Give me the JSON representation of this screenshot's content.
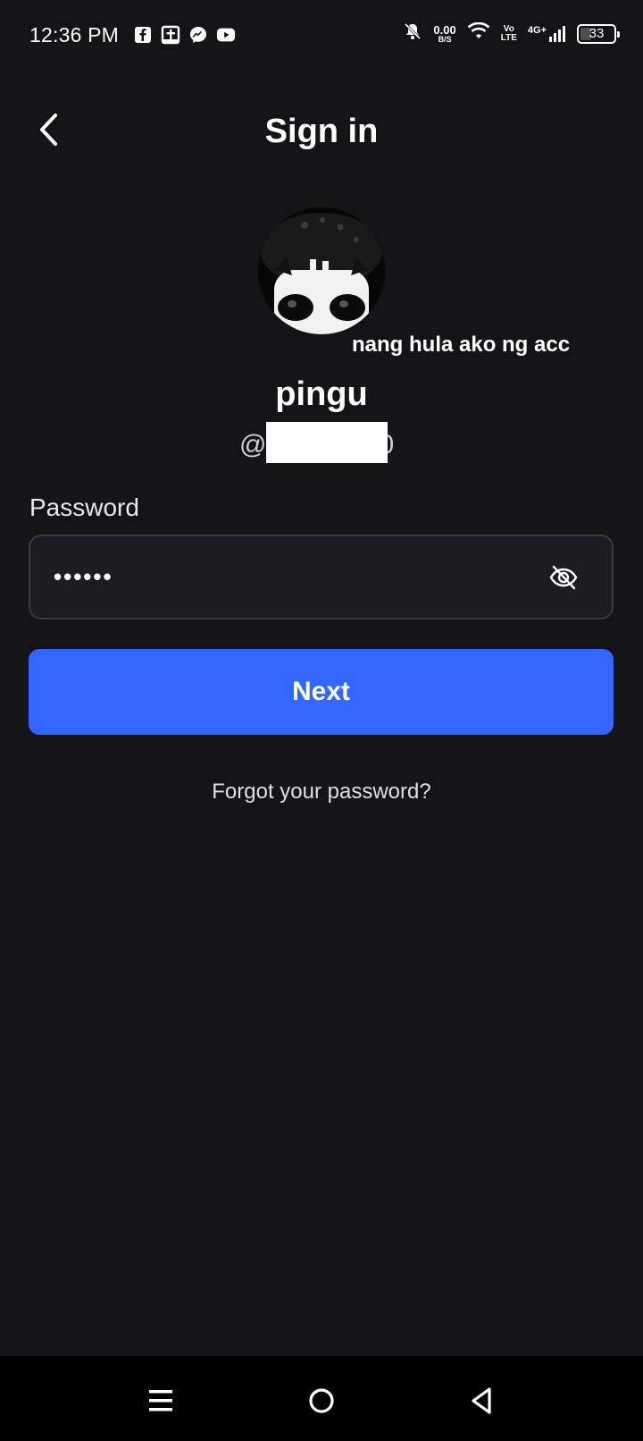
{
  "status_bar": {
    "time": "12:36 PM",
    "net_speed_value": "0.00",
    "net_speed_unit": "B/S",
    "volte_top": "Vo",
    "volte_bottom": "LTE",
    "network": "4G+",
    "battery": "33"
  },
  "header": {
    "title": "Sign in"
  },
  "profile": {
    "caption": "nang hula ako ng acc",
    "display_name": "pingu",
    "username_prefix": "@",
    "username_suffix": "0"
  },
  "password": {
    "label": "Password",
    "value": "••••••"
  },
  "actions": {
    "next_label": "Next",
    "forgot_label": "Forgot your password?"
  }
}
